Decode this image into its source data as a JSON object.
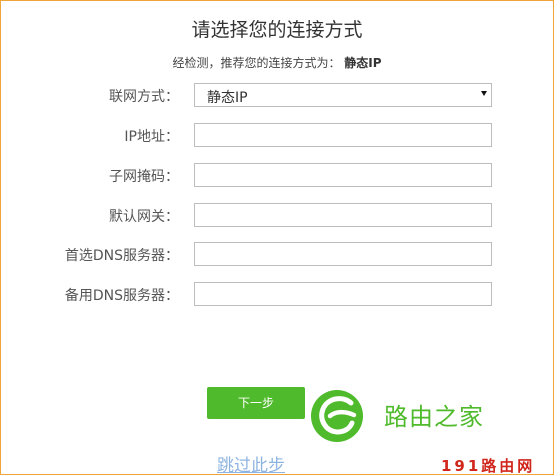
{
  "page": {
    "title": "请选择您的连接方式",
    "detect_hint_prefix": "经检测，推荐您的连接方式为：",
    "detect_hint_value": "静态IP"
  },
  "form": {
    "connection_type": {
      "label": "联网方式：",
      "selected": "静态IP"
    },
    "ip_address": {
      "label": "IP地址：",
      "value": ""
    },
    "subnet_mask": {
      "label": "子网掩码：",
      "value": ""
    },
    "default_gateway": {
      "label": "默认网关：",
      "value": ""
    },
    "primary_dns": {
      "label": "首选DNS服务器：",
      "value": ""
    },
    "secondary_dns": {
      "label": "备用DNS服务器：",
      "value": ""
    }
  },
  "actions": {
    "next_label": "下一步",
    "skip_label": "跳过此步"
  },
  "watermark": {
    "brand_text": "路由之家",
    "site_text": "191路由网"
  },
  "colors": {
    "accent_green": "#4fba2b",
    "frame_orange": "#f0a43a",
    "link_blue": "#8db4e0",
    "watermark_red": "#d0261c"
  }
}
